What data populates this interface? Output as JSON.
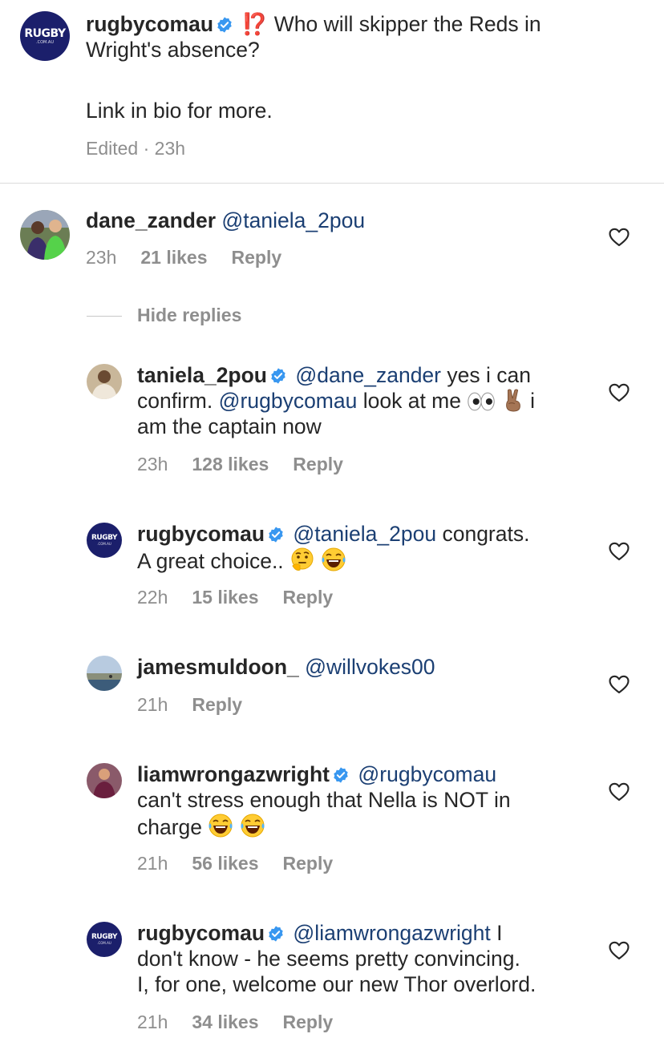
{
  "caption": {
    "username": "rugbycomau",
    "emoji_glyph": "⁉️",
    "text_line1": "Who will skipper the Reds in",
    "text_line2": "Wright's absence?",
    "text_line3": "Link in bio for more.",
    "meta": "Edited · 23h",
    "avatar_logo": "RUGBY",
    "avatar_sub": ".COM.AU"
  },
  "comments": [
    {
      "username": "dane_zander",
      "mention": "@taniela_2pou",
      "time": "23h",
      "likes": "21 likes",
      "reply": "Reply"
    }
  ],
  "hide_replies": "Hide replies",
  "replies": [
    {
      "username": "taniela_2pou",
      "mention": "@dane_zander",
      "text1": "yes i can",
      "text2a": "confirm.",
      "mention2": "@rugbycomau",
      "text2b": "look at me",
      "text2c": "i",
      "text3": "am the captain now",
      "time": "23h",
      "likes": "128 likes",
      "reply": "Reply"
    },
    {
      "username": "rugbycomau",
      "mention": "@taniela_2pou",
      "text1": "congrats.",
      "text2": "A great choice..",
      "time": "22h",
      "likes": "15 likes",
      "reply": "Reply",
      "avatar_logo": "RUGBY",
      "avatar_sub": ".COM.AU"
    },
    {
      "username": "jamesmuldoon_",
      "mention": "@willvokes00",
      "time": "21h",
      "reply": "Reply"
    },
    {
      "username": "liamwrongazwright",
      "mention": "@rugbycomau",
      "text2": "can't stress enough that Nella is NOT in",
      "text3": "charge",
      "time": "21h",
      "likes": "56 likes",
      "reply": "Reply"
    },
    {
      "username": "rugbycomau",
      "mention": "@liamwrongazwright",
      "text1": "I",
      "text2": "don't know - he seems pretty convincing.",
      "text3": "I, for one, welcome our new Thor overlord.",
      "time": "21h",
      "likes": "34 likes",
      "reply": "Reply",
      "avatar_logo": "RUGBY",
      "avatar_sub": ".COM.AU"
    }
  ],
  "colors": {
    "text": "#262626",
    "meta": "#8e8e8e",
    "mention": "#1b3f73",
    "verified": "#3897f0",
    "brand_avatar": "#1b1f6b"
  }
}
